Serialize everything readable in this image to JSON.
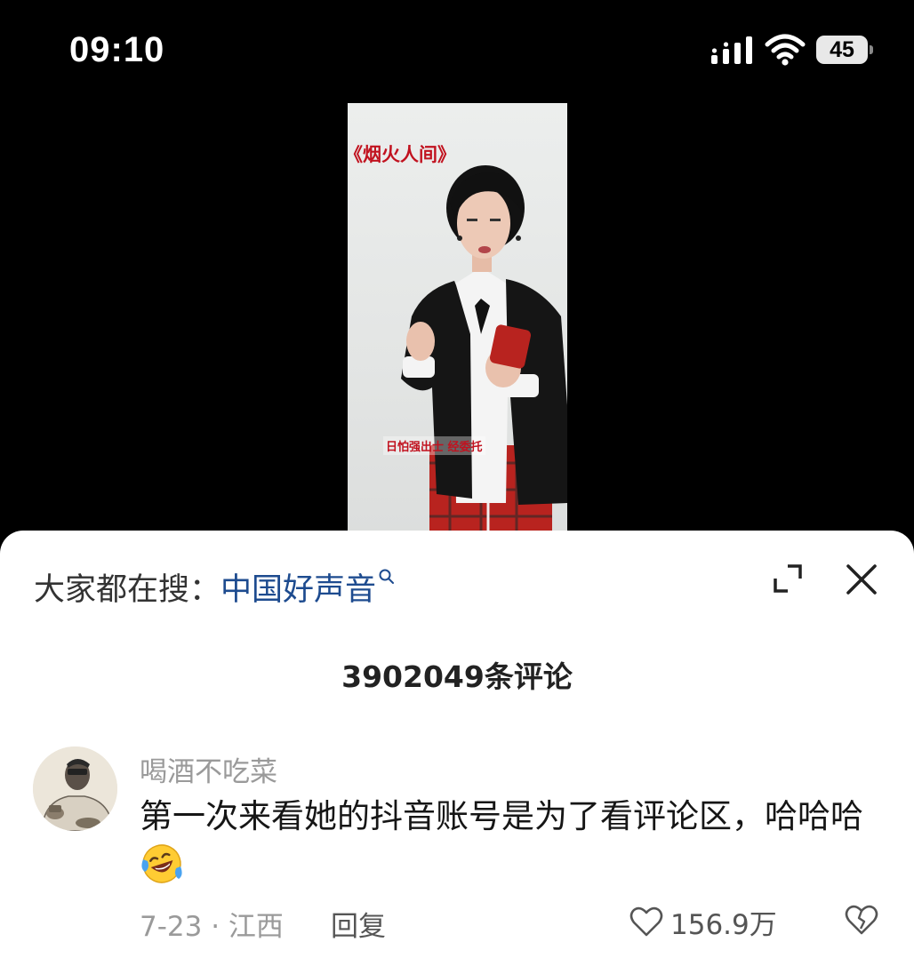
{
  "status_bar": {
    "time": "09:10",
    "battery": "45"
  },
  "video": {
    "title": "《烟火人间》",
    "caption": "日怕强出士 经委托"
  },
  "sheet": {
    "search_prefix": "大家都在搜：",
    "search_term": "中国好声音",
    "comment_count": "3902049条评论"
  },
  "comment": {
    "author": "喝酒不吃菜",
    "text": "第一次来看她的抖音账号是为了看评论区，哈哈哈",
    "meta": "7-23 · 江西",
    "reply_label": "回复",
    "likes": "156.9万"
  },
  "icons": {
    "signal": "signal-icon",
    "wifi": "wifi-icon",
    "search": "search-icon",
    "expand": "expand-icon",
    "close": "close-icon",
    "emoji": "laughing-tears-emoji-icon",
    "like": "heart-icon",
    "dislike": "broken-heart-icon"
  },
  "colors": {
    "search_term": "#1d4b8f",
    "video_title": "#c1121f",
    "secondary_text": "#9a9a9a"
  }
}
